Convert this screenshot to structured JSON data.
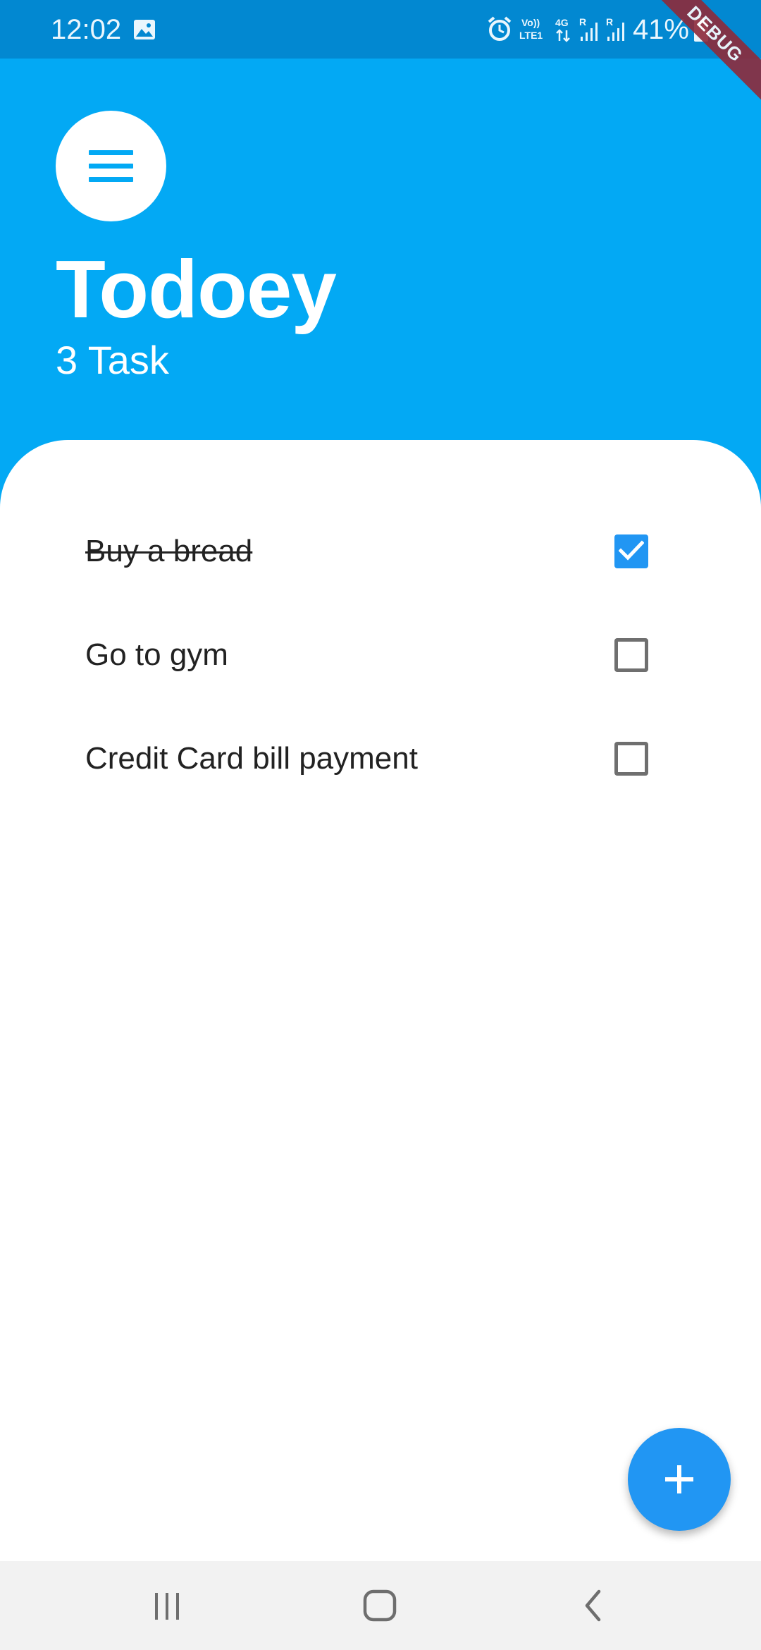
{
  "status_bar": {
    "time": "12:02",
    "battery": "41%",
    "debug_label": "DEBUG",
    "icons": [
      "image-icon",
      "alarm-icon",
      "volte-icon",
      "4g-data-icon",
      "signal-icon-1",
      "signal-icon-2",
      "battery-icon"
    ]
  },
  "header": {
    "menu_icon": "menu-icon",
    "title": "Todoey",
    "task_count": "3 Task"
  },
  "tasks": [
    {
      "label": "Buy a bread",
      "done": true
    },
    {
      "label": "Go to gym",
      "done": false
    },
    {
      "label": "Credit Card bill payment",
      "done": false
    }
  ],
  "fab": {
    "icon": "plus-icon"
  },
  "nav_bar": {
    "icons": [
      "recent-apps-icon",
      "home-icon",
      "back-icon"
    ]
  },
  "colors": {
    "header_bg": "#03A9F4",
    "status_bar_bg": "#0288D1",
    "accent": "#2196F3",
    "panel_bg": "#FFFFFF",
    "nav_bar_bg": "#F2F2F2"
  }
}
